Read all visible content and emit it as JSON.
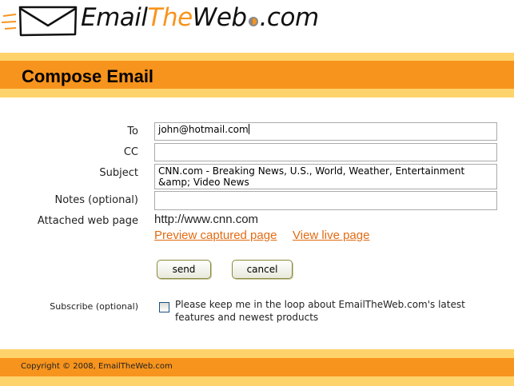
{
  "header": {
    "logo_parts": [
      "Email",
      "The",
      "Web",
      ".com"
    ],
    "page_title": "Compose Email"
  },
  "form": {
    "to": {
      "label": "To",
      "value": "john@hotmail.com"
    },
    "cc": {
      "label": "CC",
      "value": ""
    },
    "subject": {
      "label": "Subject",
      "value": "CNN.com - Breaking News, U.S., World, Weather, Entertainment &amp; Video News"
    },
    "notes": {
      "label": "Notes (optional)",
      "value": ""
    },
    "attached": {
      "label": "Attached web page",
      "url": "http://www.cnn.com",
      "preview_link": "Preview captured page",
      "live_link": "View live page"
    },
    "send_label": "send",
    "cancel_label": "cancel",
    "subscribe": {
      "label": "Subscribe (optional)",
      "text": "Please keep me in the loop about EmailTheWeb.com's latest features and newest products",
      "checked": false
    }
  },
  "footer": {
    "copyright": "Copyright © 2008, EmailTheWeb.com"
  },
  "colors": {
    "accent_orange": "#f7941d",
    "band_yellow": "#ffd36b",
    "link_orange": "#e26b13"
  },
  "icons": [
    "envelope-icon",
    "checkbox-icon"
  ]
}
